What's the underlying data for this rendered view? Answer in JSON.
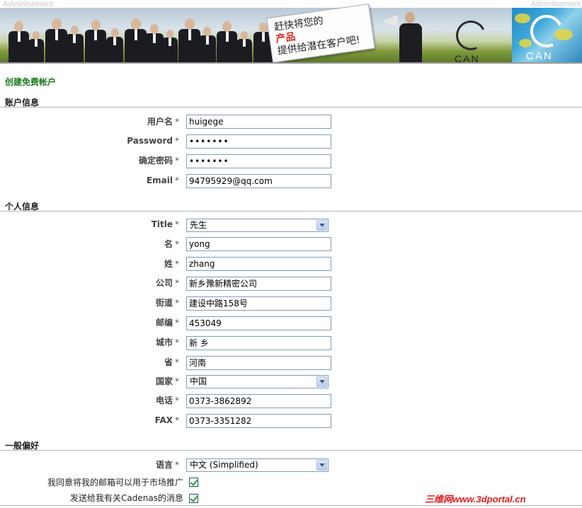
{
  "banner": {
    "ad_label_left": "Advertisement:",
    "ad_label_right": "Advertisement",
    "speech_lines": [
      "赶快将您的",
      "产品",
      "提供给潜在客户吧!"
    ],
    "logo_text": "CAN",
    "side_logo_text": "CAN"
  },
  "page_title": "创建免费帐户",
  "sections": {
    "account": "账户信息",
    "personal": "个人信息",
    "preferences": "一般偏好"
  },
  "required_mark": "*",
  "account": {
    "username": {
      "label": "用户名",
      "value": "huigege"
    },
    "password": {
      "label": "Password",
      "value": "•••••••"
    },
    "confirm": {
      "label": "确定密码",
      "value": "•••••••"
    },
    "email": {
      "label": "Email",
      "value": "94795929@qq.com"
    }
  },
  "personal": {
    "title": {
      "label": "Title",
      "value": "先生"
    },
    "first_name": {
      "label": "名",
      "value": "yong"
    },
    "last_name": {
      "label": "姓",
      "value": "zhang"
    },
    "company": {
      "label": "公司",
      "value": "新乡豫新精密公司"
    },
    "street": {
      "label": "街道",
      "value": "建设中路158号"
    },
    "zip": {
      "label": "邮编",
      "value": "453049"
    },
    "city": {
      "label": "城市",
      "value": "新 乡"
    },
    "province": {
      "label": "省",
      "value": "河南"
    },
    "country": {
      "label": "国家",
      "value": "中国"
    },
    "phone": {
      "label": "电话",
      "value": "0373-3862892"
    },
    "fax": {
      "label": "FAX",
      "value": "0373-3351282"
    }
  },
  "preferences": {
    "language": {
      "label": "语言",
      "value": "中文 (Simplified)"
    },
    "marketing_consent": {
      "label": "我同意将我的邮箱可以用于市场推广",
      "checked": true
    },
    "cadenas_news": {
      "label": "发送给我有关Cadenas的消息",
      "checked": true
    }
  },
  "watermark": "三维网www.3dportal.cn",
  "colors": {
    "title_green": "#1d7a1d",
    "field_border": "#7f9db9",
    "check_green": "#21a121",
    "watermark_red": "#e41b1b"
  }
}
